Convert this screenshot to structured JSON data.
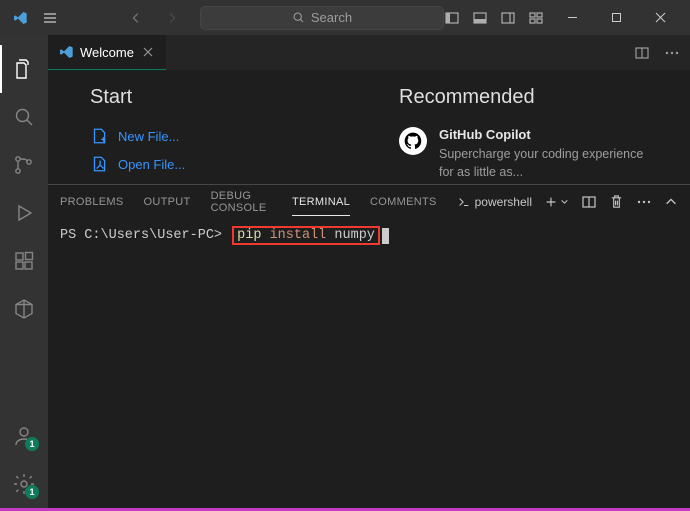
{
  "titlebar": {
    "search_placeholder": "Search"
  },
  "tab": {
    "title": "Welcome"
  },
  "welcome": {
    "start_heading": "Start",
    "new_file": "New File...",
    "open_file": "Open File...",
    "rec_heading": "Recommended",
    "rec_title": "GitHub Copilot",
    "rec_desc": "Supercharge your coding experience for as little as..."
  },
  "panel": {
    "tabs": {
      "problems": "PROBLEMS",
      "output": "OUTPUT",
      "debug": "DEBUG CONSOLE",
      "terminal": "TERMINAL",
      "comments": "COMMENTS"
    },
    "shell": "powershell"
  },
  "terminal": {
    "prompt": "PS C:\\Users\\User-PC>",
    "word1": "pip",
    "word2": "install",
    "word3": "numpy"
  },
  "activity": {
    "accounts_badge": "1",
    "settings_badge": "1"
  }
}
